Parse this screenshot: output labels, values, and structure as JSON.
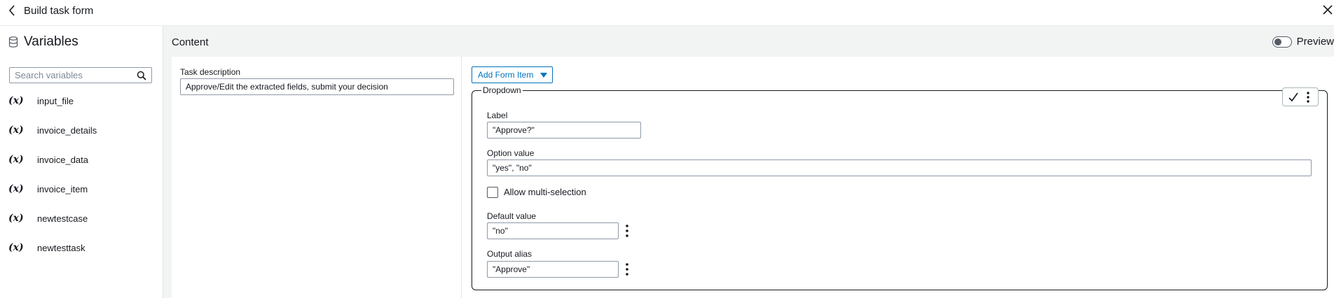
{
  "header": {
    "title": "Build task form",
    "back_icon": "chevron-left-icon",
    "close_icon": "close-icon"
  },
  "sidebar": {
    "title": "Variables",
    "title_icon": "database-icon",
    "search": {
      "placeholder": "Search variables",
      "value": "",
      "icon": "search-icon"
    },
    "variables": [
      {
        "symbol": "(x)",
        "label": "input_file"
      },
      {
        "symbol": "(x)",
        "label": "invoice_details"
      },
      {
        "symbol": "(x)",
        "label": "invoice_data"
      },
      {
        "symbol": "(x)",
        "label": "invoice_item"
      },
      {
        "symbol": "(x)",
        "label": "newtestcase"
      },
      {
        "symbol": "(x)",
        "label": "newtesttask"
      }
    ]
  },
  "main": {
    "title": "Content",
    "preview": {
      "label": "Preview",
      "enabled": false
    },
    "task_description": {
      "label": "Task description",
      "value": "Approve/Edit the extracted fields, submit your decision"
    },
    "add_form_item": {
      "label": "Add Form Item",
      "icon": "caret-down-icon"
    },
    "dropdown": {
      "legend": "Dropdown",
      "actions": {
        "confirm_icon": "check-icon",
        "more_icon": "kebab-icon"
      },
      "label_field": {
        "label": "Label",
        "value": "\"Approve?\""
      },
      "option_value": {
        "label": "Option value",
        "value": "\"yes\", \"no\""
      },
      "allow_multi": {
        "label": "Allow multi-selection",
        "checked": false
      },
      "default_value": {
        "label": "Default value",
        "value": "\"no\""
      },
      "output_alias": {
        "label": "Output alias",
        "value": "\"Approve\""
      }
    }
  },
  "colors": {
    "accent": "#0073bb",
    "text": "#16191f",
    "panel_bg": "#f2f3f3",
    "border": "#8d99a8"
  }
}
